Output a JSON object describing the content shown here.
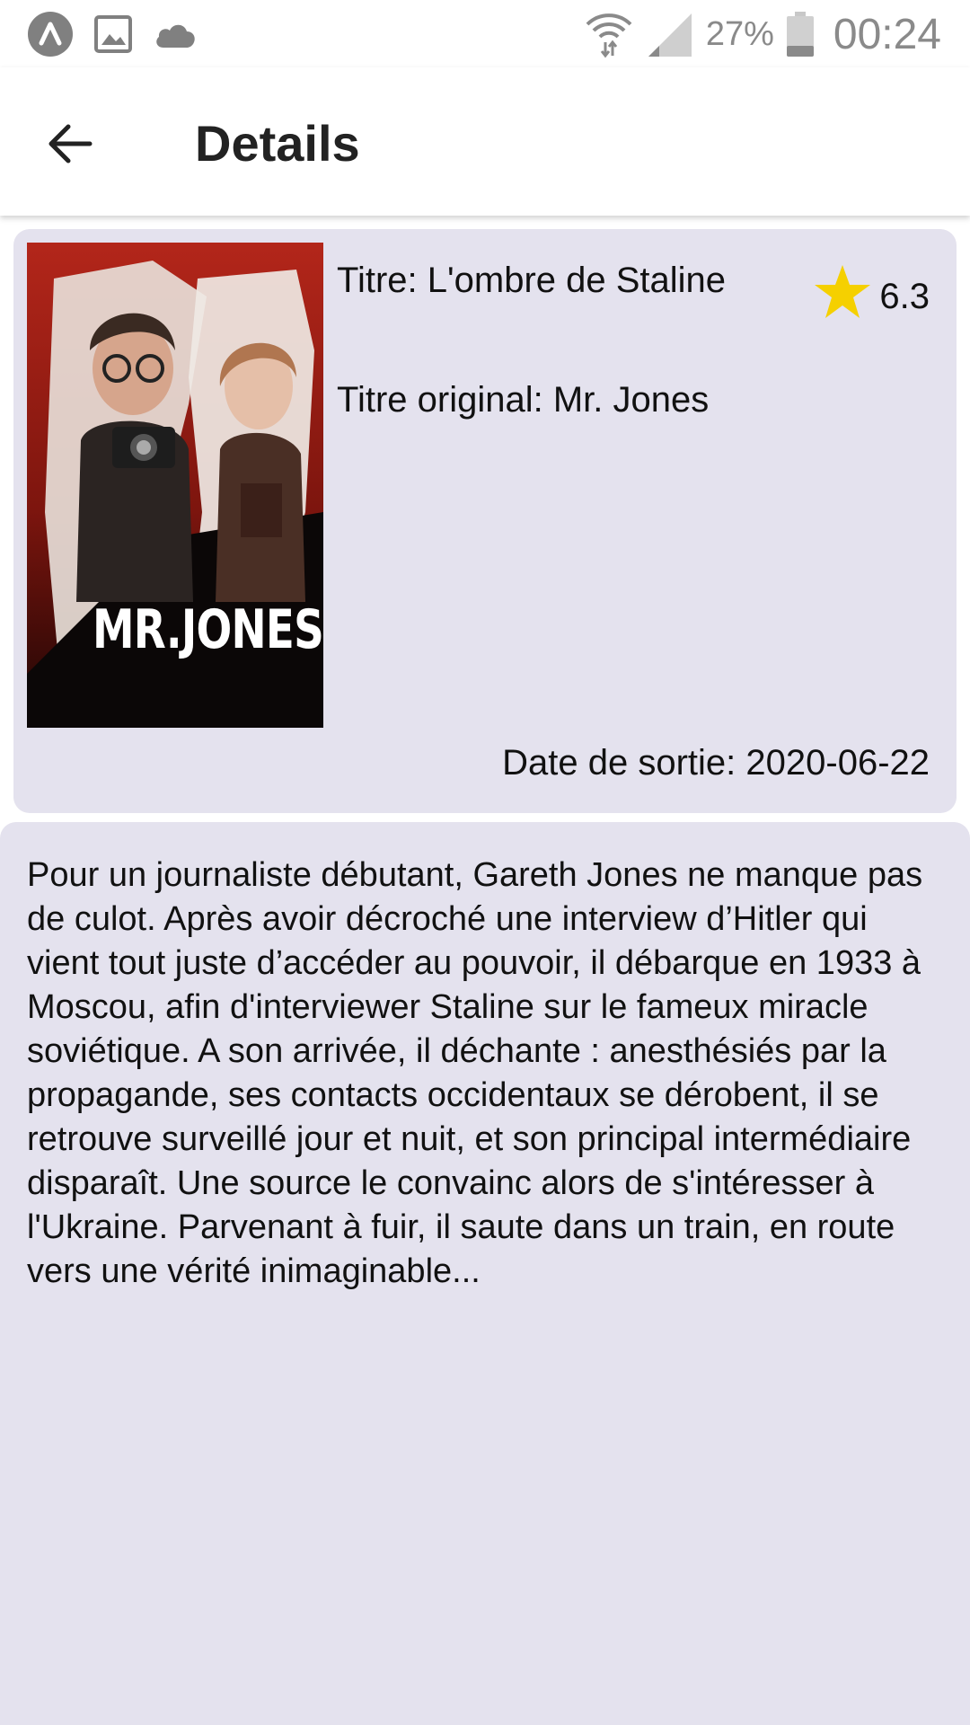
{
  "status_bar": {
    "icons_left": [
      "app-a-icon",
      "image-icon",
      "cloud-icon"
    ],
    "icons_right": [
      "wifi-icon",
      "signal-icon",
      "battery-icon"
    ],
    "battery": "27%",
    "time": "00:24"
  },
  "app_bar": {
    "back_icon": "arrow-back-icon",
    "title": "Details"
  },
  "movie": {
    "poster_text": "MR.JONES",
    "title": "Titre: L'ombre de Staline",
    "original_title": "Titre original: Mr. Jones",
    "rating": "6.3",
    "rating_icon": "star-icon",
    "release_date": "Date de sortie: 2020-06-22",
    "overview": "Pour un journaliste débutant, Gareth Jones ne manque pas de culot. Après avoir décroché une interview d’Hitler qui vient tout juste d’accéder au pouvoir, il débarque en 1933 à Moscou, afin d'interviewer Staline sur le fameux miracle soviétique. A son arrivée, il déchante : anesthésiés par la propagande, ses contacts occidentaux se dérobent, il se retrouve surveillé jour et nuit, et son principal intermédiaire disparaît. Une source le convainc alors de s'intéresser à l'Ukraine. Parvenant à fuir, il saute dans un train, en route vers une vérité inimaginable..."
  },
  "colors": {
    "card_background": "#e4e2ee",
    "star": "#f5d000",
    "poster_red": "#8f1a12"
  }
}
